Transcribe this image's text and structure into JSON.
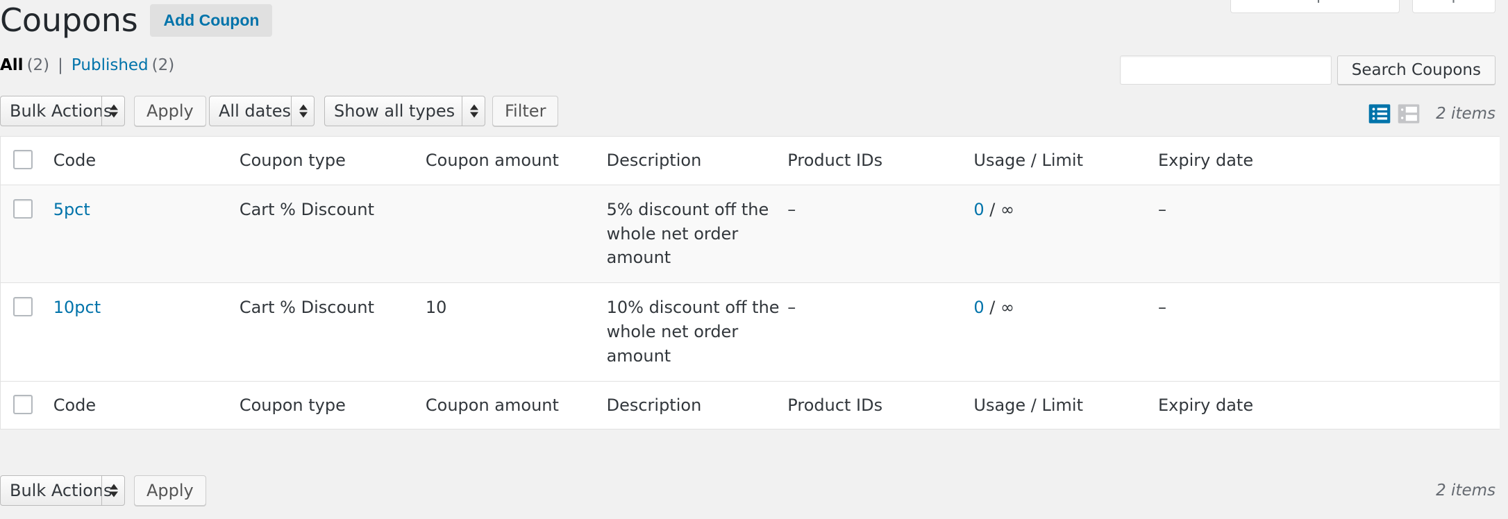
{
  "screen_meta": {
    "screen_options_label": "Screen Options",
    "help_label": "Help"
  },
  "header": {
    "page_title": "Coupons",
    "add_button_label": "Add Coupon"
  },
  "status_links": {
    "all_label": "All",
    "all_count": "(2)",
    "separator": "|",
    "published_label": "Published",
    "published_count": "(2)"
  },
  "search": {
    "value": "",
    "placeholder": "",
    "submit_label": "Search Coupons"
  },
  "tablenav_top": {
    "bulk_actions_label": "Bulk Actions",
    "apply_label": "Apply",
    "date_filter_label": "All dates",
    "type_filter_label": "Show all types",
    "filter_label": "Filter",
    "list_view_icon": "list-view-icon",
    "excerpt_view_icon": "excerpt-view-icon",
    "items_count": "2 items"
  },
  "table": {
    "columns": [
      "Code",
      "Coupon type",
      "Coupon amount",
      "Description",
      "Product IDs",
      "Usage / Limit",
      "Expiry date"
    ],
    "rows": [
      {
        "code": "5pct",
        "coupon_type": "Cart % Discount",
        "coupon_amount": "",
        "description": "5% discount off the whole net order amount",
        "product_ids": "–",
        "usage": "0",
        "usage_sep": "/",
        "limit": "∞",
        "expiry_date": "–"
      },
      {
        "code": "10pct",
        "coupon_type": "Cart % Discount",
        "coupon_amount": "10",
        "description": "10% discount off the whole net order amount",
        "product_ids": "–",
        "usage": "0",
        "usage_sep": "/",
        "limit": "∞",
        "expiry_date": "–"
      }
    ]
  },
  "tablenav_bottom": {
    "bulk_actions_label": "Bulk Actions",
    "apply_label": "Apply",
    "items_count": "2 items"
  },
  "colors": {
    "link": "#0073aa",
    "page_bg": "#f1f1f1",
    "row_alt_bg": "#f9f9f9",
    "border": "#e1e1e1",
    "active_view_icon": "#0073aa",
    "inactive_view_icon": "#c3c4c7"
  }
}
